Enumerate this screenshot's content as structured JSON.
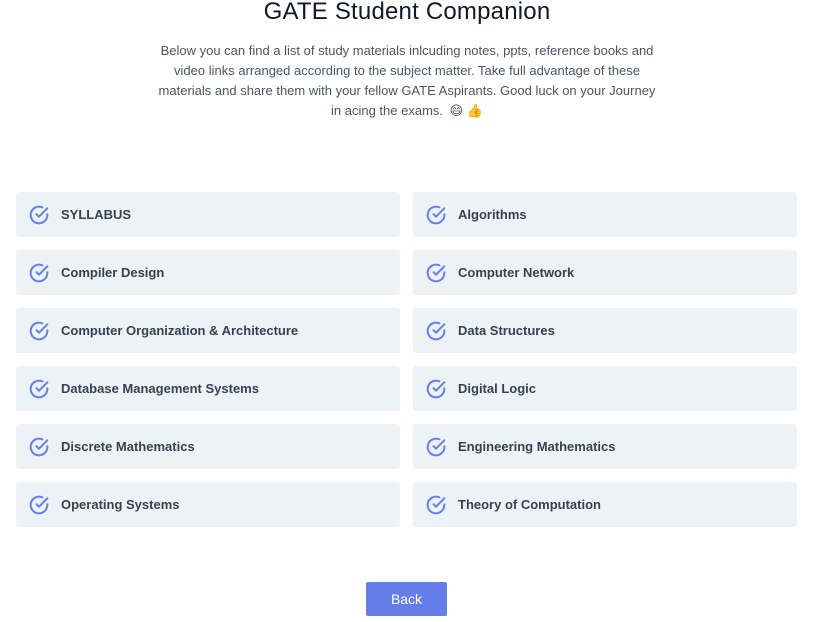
{
  "page": {
    "title": "GATE Student Companion",
    "intro": "Below you can find a list of study materials inlcuding notes, ppts, reference books and video links arranged according to the subject matter. Take full advantage of these materials and share them with your fellow GATE Aspirants. Good luck on your Journey in acing the exams.",
    "intro_emojis": "😄 👍"
  },
  "subjects": [
    {
      "label": "SYLLABUS",
      "icon": "check-circle-icon"
    },
    {
      "label": "Algorithms",
      "icon": "check-circle-icon"
    },
    {
      "label": "Compiler Design",
      "icon": "check-circle-icon"
    },
    {
      "label": "Computer Network",
      "icon": "check-circle-icon"
    },
    {
      "label": "Computer Organization & Architecture",
      "icon": "check-circle-icon"
    },
    {
      "label": "Data Structures",
      "icon": "check-circle-icon"
    },
    {
      "label": "Database Management Systems",
      "icon": "check-circle-icon"
    },
    {
      "label": "Digital Logic",
      "icon": "check-circle-icon"
    },
    {
      "label": "Discrete Mathematics",
      "icon": "check-circle-icon"
    },
    {
      "label": "Engineering Mathematics",
      "icon": "check-circle-icon"
    },
    {
      "label": "Operating Systems",
      "icon": "check-circle-icon"
    },
    {
      "label": "Theory of Computation",
      "icon": "check-circle-icon"
    }
  ],
  "back_button": {
    "label": "Back"
  },
  "colors": {
    "accent": "#667eea",
    "card_background": "#edf2f7",
    "text": "#374151"
  }
}
